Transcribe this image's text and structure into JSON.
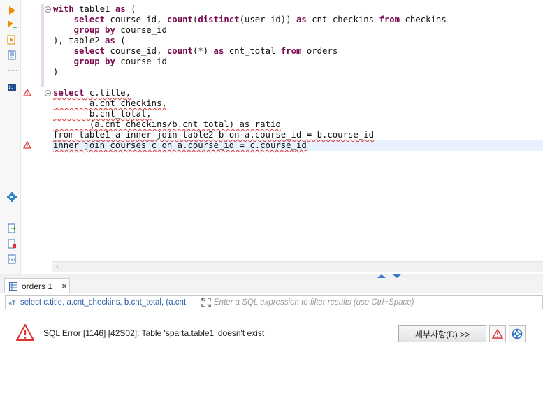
{
  "editor": {
    "lines": [
      [
        {
          "t": "with",
          "k": 1
        },
        {
          "t": " table1 "
        },
        {
          "t": "as",
          "k": 1
        },
        {
          "t": " ("
        }
      ],
      [
        {
          "t": "    "
        },
        {
          "t": "select",
          "k": 1
        },
        {
          "t": " course_id, "
        },
        {
          "t": "count",
          "k": 1
        },
        {
          "t": "("
        },
        {
          "t": "distinct",
          "k": 1
        },
        {
          "t": "(user_id)) "
        },
        {
          "t": "as",
          "k": 1
        },
        {
          "t": " cnt_checkins "
        },
        {
          "t": "from",
          "k": 1
        },
        {
          "t": " checkins"
        }
      ],
      [
        {
          "t": "    "
        },
        {
          "t": "group by",
          "k": 1
        },
        {
          "t": " course_id"
        }
      ],
      [
        {
          "t": "), table2 "
        },
        {
          "t": "as",
          "k": 1
        },
        {
          "t": " ("
        }
      ],
      [
        {
          "t": "    "
        },
        {
          "t": "select",
          "k": 1
        },
        {
          "t": " course_id, "
        },
        {
          "t": "count",
          "k": 1
        },
        {
          "t": "(*) "
        },
        {
          "t": "as",
          "k": 1
        },
        {
          "t": " cnt_total "
        },
        {
          "t": "from",
          "k": 1
        },
        {
          "t": " orders"
        }
      ],
      [
        {
          "t": "    "
        },
        {
          "t": "group by",
          "k": 1
        },
        {
          "t": " course_id"
        }
      ],
      [
        {
          "t": ")"
        }
      ],
      [],
      [
        {
          "t": "select",
          "k": 1,
          "u": 1
        },
        {
          "t": " c.title,",
          "u": 1
        }
      ],
      [
        {
          "t": "       a.cnt_checkins,",
          "u": 1
        }
      ],
      [
        {
          "t": "       b.cnt_total,",
          "u": 1
        }
      ],
      [
        {
          "t": "       (a.cnt_checkins/b.cnt_total) as ratio",
          "u": 1
        }
      ],
      [
        {
          "t": "from table1 a inner join table2 b on a.course_id = b.course_id",
          "u": 1
        }
      ],
      [
        {
          "t": "inner join courses c on a.course_id = c.course_id",
          "u": 1
        }
      ]
    ]
  },
  "results": {
    "tab_label": "orders 1",
    "query_echo": "select c.title, a.cnt_checkins, b.cnt_total, (a.cnt",
    "filter_placeholder": "Enter a SQL expression to filter results (use Ctrl+Space)",
    "error_message": "SQL Error [1146] [42S02]: Table 'sparta.table1' doesn't exist",
    "details_button": "세부사항(D) >>"
  },
  "colors": {
    "keyword": "#7b0b4f",
    "error_red": "#d33333",
    "current_line": "#e8f2fe",
    "link_blue": "#2a5cab"
  }
}
